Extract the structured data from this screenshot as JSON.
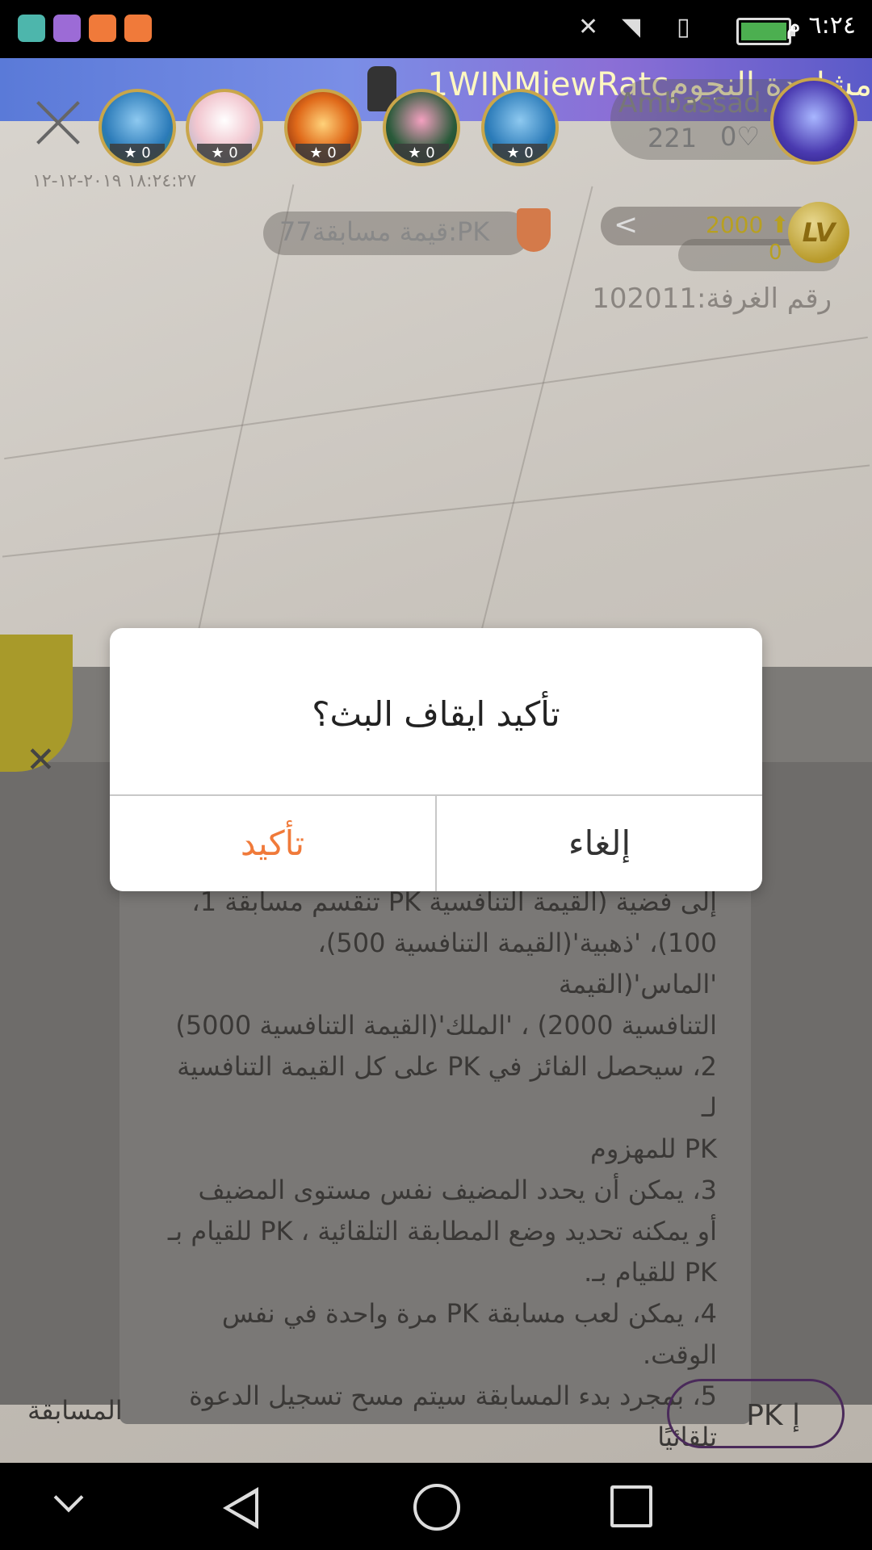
{
  "status_bar": {
    "time": "٦:٢٤ م",
    "apps": [
      "android-icon",
      "gallery-icon",
      "music-icon",
      "music-icon"
    ]
  },
  "banner": {
    "text": "1WINMiewRatcمشاهدة النجوم"
  },
  "live": {
    "datetime": "١٨:٢٤:٢٧ ٢٠١٩-١٢-١٢",
    "viewers": [
      {
        "stars": "0"
      },
      {
        "stars": "0"
      },
      {
        "stars": "0"
      },
      {
        "stars": "0"
      },
      {
        "stars": "0"
      }
    ],
    "host": {
      "name": "Ambassad...",
      "count": "221",
      "hearts": "0"
    },
    "pk_value": "قيمة مسابقة77:PK",
    "level": {
      "coins": "2000",
      "coins_sub": "0",
      "badge": "LV"
    },
    "room_number": "رقم الغرفة:102011"
  },
  "panel": {
    "rules_text": "إلى فضية (القيمة التنافسية PK تنقسم مسابقة 1،\n100)، 'ذهبية'(القيمة التنافسية 500)، 'الماس'(القيمة\nالتنافسية 2000) ، 'الملك'(القيمة التنافسية 5000)\n2، سيحصل الفائز في PK على كل القيمة التنافسية لـ\nPK للمهزوم\n3، يمكن أن يحدد المضيف نفس مستوى المضيف\nأو يمكنه تحديد وضع المطابقة التلقائية ، PK للقيام بـ\nPK للقيام بـ.\n4، يمكن لعب مسابقة PK مرة واحدة في نفس\nالوقت.\n5، بمجرد بدء المسابقة سيتم مسح تسجيل الدعوة\nتلقائيًا",
    "pk_button": "PK إ",
    "match_label": "المسابقة"
  },
  "dialog": {
    "title": "تأكيد ايقاف البث؟",
    "confirm": "تأكيد",
    "cancel": "إلغاء"
  },
  "colors": {
    "confirm_accent": "#f07a3a",
    "banner": "#7a8ee6"
  }
}
